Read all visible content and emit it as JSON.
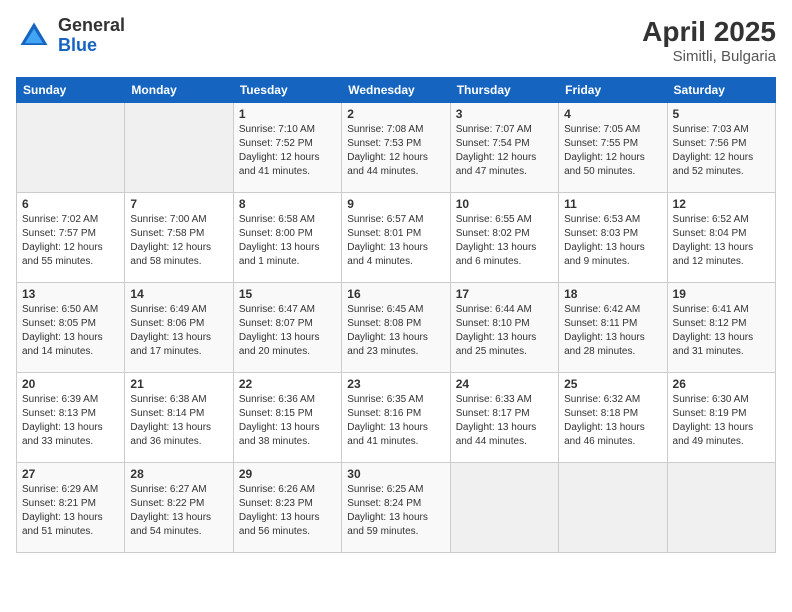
{
  "logo": {
    "general": "General",
    "blue": "Blue"
  },
  "title": {
    "month_year": "April 2025",
    "location": "Simitli, Bulgaria"
  },
  "days_of_week": [
    "Sunday",
    "Monday",
    "Tuesday",
    "Wednesday",
    "Thursday",
    "Friday",
    "Saturday"
  ],
  "weeks": [
    [
      {
        "day": "",
        "info": ""
      },
      {
        "day": "",
        "info": ""
      },
      {
        "day": "1",
        "info": "Sunrise: 7:10 AM\nSunset: 7:52 PM\nDaylight: 12 hours and 41 minutes."
      },
      {
        "day": "2",
        "info": "Sunrise: 7:08 AM\nSunset: 7:53 PM\nDaylight: 12 hours and 44 minutes."
      },
      {
        "day": "3",
        "info": "Sunrise: 7:07 AM\nSunset: 7:54 PM\nDaylight: 12 hours and 47 minutes."
      },
      {
        "day": "4",
        "info": "Sunrise: 7:05 AM\nSunset: 7:55 PM\nDaylight: 12 hours and 50 minutes."
      },
      {
        "day": "5",
        "info": "Sunrise: 7:03 AM\nSunset: 7:56 PM\nDaylight: 12 hours and 52 minutes."
      }
    ],
    [
      {
        "day": "6",
        "info": "Sunrise: 7:02 AM\nSunset: 7:57 PM\nDaylight: 12 hours and 55 minutes."
      },
      {
        "day": "7",
        "info": "Sunrise: 7:00 AM\nSunset: 7:58 PM\nDaylight: 12 hours and 58 minutes."
      },
      {
        "day": "8",
        "info": "Sunrise: 6:58 AM\nSunset: 8:00 PM\nDaylight: 13 hours and 1 minute."
      },
      {
        "day": "9",
        "info": "Sunrise: 6:57 AM\nSunset: 8:01 PM\nDaylight: 13 hours and 4 minutes."
      },
      {
        "day": "10",
        "info": "Sunrise: 6:55 AM\nSunset: 8:02 PM\nDaylight: 13 hours and 6 minutes."
      },
      {
        "day": "11",
        "info": "Sunrise: 6:53 AM\nSunset: 8:03 PM\nDaylight: 13 hours and 9 minutes."
      },
      {
        "day": "12",
        "info": "Sunrise: 6:52 AM\nSunset: 8:04 PM\nDaylight: 13 hours and 12 minutes."
      }
    ],
    [
      {
        "day": "13",
        "info": "Sunrise: 6:50 AM\nSunset: 8:05 PM\nDaylight: 13 hours and 14 minutes."
      },
      {
        "day": "14",
        "info": "Sunrise: 6:49 AM\nSunset: 8:06 PM\nDaylight: 13 hours and 17 minutes."
      },
      {
        "day": "15",
        "info": "Sunrise: 6:47 AM\nSunset: 8:07 PM\nDaylight: 13 hours and 20 minutes."
      },
      {
        "day": "16",
        "info": "Sunrise: 6:45 AM\nSunset: 8:08 PM\nDaylight: 13 hours and 23 minutes."
      },
      {
        "day": "17",
        "info": "Sunrise: 6:44 AM\nSunset: 8:10 PM\nDaylight: 13 hours and 25 minutes."
      },
      {
        "day": "18",
        "info": "Sunrise: 6:42 AM\nSunset: 8:11 PM\nDaylight: 13 hours and 28 minutes."
      },
      {
        "day": "19",
        "info": "Sunrise: 6:41 AM\nSunset: 8:12 PM\nDaylight: 13 hours and 31 minutes."
      }
    ],
    [
      {
        "day": "20",
        "info": "Sunrise: 6:39 AM\nSunset: 8:13 PM\nDaylight: 13 hours and 33 minutes."
      },
      {
        "day": "21",
        "info": "Sunrise: 6:38 AM\nSunset: 8:14 PM\nDaylight: 13 hours and 36 minutes."
      },
      {
        "day": "22",
        "info": "Sunrise: 6:36 AM\nSunset: 8:15 PM\nDaylight: 13 hours and 38 minutes."
      },
      {
        "day": "23",
        "info": "Sunrise: 6:35 AM\nSunset: 8:16 PM\nDaylight: 13 hours and 41 minutes."
      },
      {
        "day": "24",
        "info": "Sunrise: 6:33 AM\nSunset: 8:17 PM\nDaylight: 13 hours and 44 minutes."
      },
      {
        "day": "25",
        "info": "Sunrise: 6:32 AM\nSunset: 8:18 PM\nDaylight: 13 hours and 46 minutes."
      },
      {
        "day": "26",
        "info": "Sunrise: 6:30 AM\nSunset: 8:19 PM\nDaylight: 13 hours and 49 minutes."
      }
    ],
    [
      {
        "day": "27",
        "info": "Sunrise: 6:29 AM\nSunset: 8:21 PM\nDaylight: 13 hours and 51 minutes."
      },
      {
        "day": "28",
        "info": "Sunrise: 6:27 AM\nSunset: 8:22 PM\nDaylight: 13 hours and 54 minutes."
      },
      {
        "day": "29",
        "info": "Sunrise: 6:26 AM\nSunset: 8:23 PM\nDaylight: 13 hours and 56 minutes."
      },
      {
        "day": "30",
        "info": "Sunrise: 6:25 AM\nSunset: 8:24 PM\nDaylight: 13 hours and 59 minutes."
      },
      {
        "day": "",
        "info": ""
      },
      {
        "day": "",
        "info": ""
      },
      {
        "day": "",
        "info": ""
      }
    ]
  ]
}
